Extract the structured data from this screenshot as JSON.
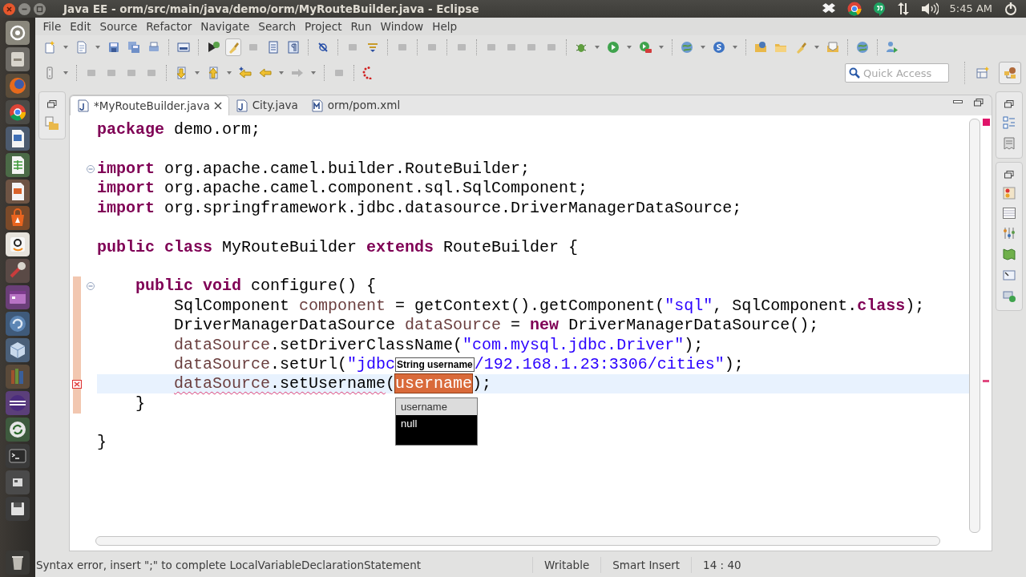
{
  "window": {
    "title": "Java EE - orm/src/main/java/demo/orm/MyRouteBuilder.java - Eclipse",
    "clock": "5:45 AM"
  },
  "menu": [
    "File",
    "Edit",
    "Source",
    "Refactor",
    "Navigate",
    "Search",
    "Project",
    "Run",
    "Window",
    "Help"
  ],
  "quick_access": {
    "placeholder": "Quick Access"
  },
  "editor_tabs": [
    {
      "label": "*MyRouteBuilder.java",
      "selected": true,
      "kind": "java"
    },
    {
      "label": "City.java",
      "selected": false,
      "kind": "java"
    },
    {
      "label": "orm/pom.xml",
      "selected": false,
      "kind": "maven"
    }
  ],
  "code": {
    "lines": [
      {
        "foldable": false,
        "error": false,
        "changed": false,
        "current": false,
        "tokens": [
          {
            "text": "package",
            "kind": "keyword"
          },
          {
            "text": " demo.orm;",
            "kind": "plain"
          }
        ]
      },
      {
        "foldable": false,
        "error": false,
        "changed": false,
        "current": false
      },
      {
        "foldable": true,
        "error": false,
        "changed": false,
        "current": false,
        "tokens": [
          {
            "text": "import",
            "kind": "keyword"
          },
          {
            "text": " org.apache.camel.builder.RouteBuilder;",
            "kind": "plain"
          }
        ]
      },
      {
        "foldable": false,
        "error": false,
        "changed": false,
        "current": false,
        "tokens": [
          {
            "text": "import",
            "kind": "keyword"
          },
          {
            "text": " org.apache.camel.component.sql.SqlComponent;",
            "kind": "plain"
          }
        ]
      },
      {
        "foldable": false,
        "error": false,
        "changed": false,
        "current": false,
        "tokens": [
          {
            "text": "import",
            "kind": "keyword"
          },
          {
            "text": " org.springframework.jdbc.datasource.DriverManagerDataSource;",
            "kind": "plain"
          }
        ]
      },
      {
        "foldable": false,
        "error": false,
        "changed": false,
        "current": false
      },
      {
        "foldable": false,
        "error": false,
        "changed": false,
        "current": false,
        "tokens": [
          {
            "text": "public class",
            "kind": "keyword"
          },
          {
            "text": " MyRouteBuilder ",
            "kind": "plain"
          },
          {
            "text": "extends",
            "kind": "keyword"
          },
          {
            "text": " RouteBuilder {",
            "kind": "plain"
          }
        ],
        "children": [
          {
            "foldable": false,
            "error": false,
            "changed": false,
            "current": false
          },
          {
            "foldable": true,
            "error": false,
            "changed": true,
            "current": false,
            "tokens": [
              {
                "text": "public void",
                "kind": "keyword"
              },
              {
                "text": " configure() {",
                "kind": "plain"
              }
            ],
            "children": [
              {
                "foldable": false,
                "error": false,
                "changed": true,
                "current": false,
                "tokens": [
                  {
                    "text": "SqlComponent ",
                    "kind": "plain"
                  },
                  {
                    "text": "component",
                    "kind": "field"
                  },
                  {
                    "text": " = getContext().getComponent(",
                    "kind": "plain"
                  },
                  {
                    "text": "\"sql\"",
                    "kind": "string"
                  },
                  {
                    "text": ", SqlComponent.",
                    "kind": "plain"
                  },
                  {
                    "text": "class",
                    "kind": "keyword"
                  },
                  {
                    "text": ");",
                    "kind": "plain"
                  }
                ]
              },
              {
                "foldable": false,
                "error": false,
                "changed": true,
                "current": false,
                "tokens": [
                  {
                    "text": "DriverManagerDataSource ",
                    "kind": "plain"
                  },
                  {
                    "text": "dataSource",
                    "kind": "field"
                  },
                  {
                    "text": " = ",
                    "kind": "plain"
                  },
                  {
                    "text": "new",
                    "kind": "keyword"
                  },
                  {
                    "text": " DriverManagerDataSource();",
                    "kind": "plain"
                  }
                ]
              },
              {
                "foldable": false,
                "error": false,
                "changed": true,
                "current": false,
                "tokens": [
                  {
                    "text": "dataSource",
                    "kind": "field"
                  },
                  {
                    "text": ".setDriverClassName(",
                    "kind": "plain"
                  },
                  {
                    "text": "\"com.mysql.jdbc.Driver\"",
                    "kind": "string"
                  },
                  {
                    "text": ");",
                    "kind": "plain"
                  }
                ]
              },
              {
                "foldable": false,
                "error": false,
                "changed": true,
                "current": false,
                "tokens": [
                  {
                    "text": "dataSource",
                    "kind": "field"
                  },
                  {
                    "text": ".setUrl(",
                    "kind": "plain"
                  },
                  {
                    "text": "\"jdbc",
                    "kind": "string"
                  },
                  {
                    "text": "String username",
                    "kind": "tooltip"
                  },
                  {
                    "text": "/192.168.1.23:3306/cities\"",
                    "kind": "string"
                  },
                  {
                    "text": ");",
                    "kind": "plain"
                  }
                ]
              },
              {
                "foldable": false,
                "error": true,
                "changed": true,
                "current": true,
                "tokens": [
                  {
                    "text": "dataSource",
                    "kind": "field_error"
                  },
                  {
                    "text": ".setUsername",
                    "kind": "plain_error"
                  },
                  {
                    "text": "(",
                    "kind": "plain"
                  },
                  {
                    "text": "username",
                    "kind": "linked"
                  },
                  {
                    "text": ");",
                    "kind": "plain"
                  }
                ]
              }
            ]
          },
          {
            "foldable": false,
            "error": false,
            "changed": true,
            "current": false,
            "tokens": [
              {
                "text": "}",
                "kind": "plain"
              }
            ]
          }
        ]
      },
      {
        "foldable": false,
        "error": false,
        "changed": false,
        "current": false
      },
      {
        "foldable": false,
        "error": false,
        "changed": false,
        "current": false,
        "tokens": [
          {
            "text": "}",
            "kind": "plain"
          }
        ]
      }
    ]
  },
  "completion": [
    {
      "label": "username",
      "selected": true
    },
    {
      "label": "null",
      "selected": false
    }
  ],
  "status_bar": {
    "message": "Syntax error, insert \";\" to complete LocalVariableDeclarationStatement",
    "write_mode": "Writable",
    "insert_mode": "Smart Insert",
    "position": "14 : 40"
  }
}
